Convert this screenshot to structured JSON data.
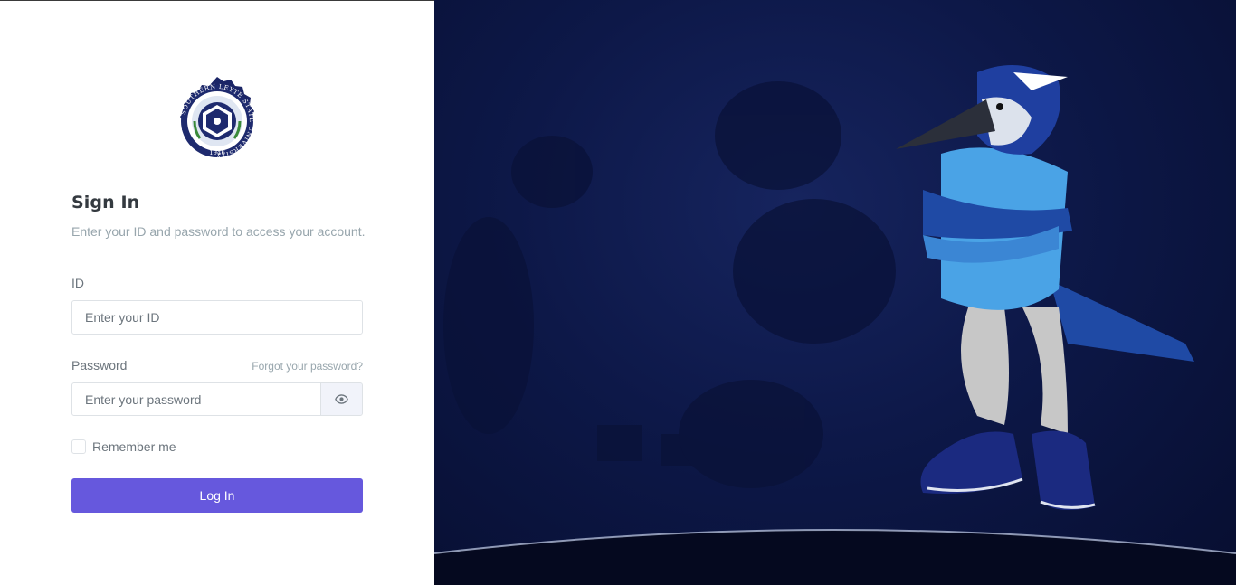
{
  "brand": {
    "seal_text": "SOUTHERN LEYTE STATE UNIVERSITY",
    "seal_year": "1946"
  },
  "login": {
    "title": "Sign In",
    "subtitle": "Enter your ID and password to access your account.",
    "id_label": "ID",
    "id_placeholder": "Enter your ID",
    "password_label": "Password",
    "forgot_password": "Forgot your password?",
    "password_placeholder": "Enter your password",
    "remember_me": "Remember me",
    "login_button": "Log In"
  },
  "icons": {
    "show_password": "eye-icon"
  },
  "colors": {
    "accent": "#6658dd",
    "background_panel": "#0d1848",
    "mascot_shirt": "#4aa3e6"
  }
}
